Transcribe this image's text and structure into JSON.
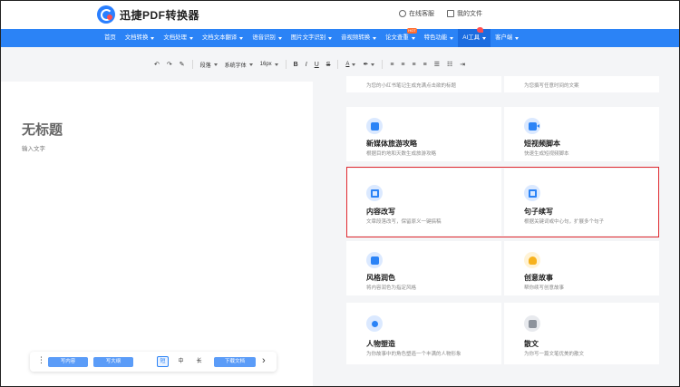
{
  "header": {
    "logo_text": "迅捷PDF转换器",
    "links": [
      {
        "label": "在线客服",
        "icon": "headset-icon"
      },
      {
        "label": "我的文件",
        "icon": "folder-icon"
      }
    ]
  },
  "nav": {
    "items": [
      {
        "label": "首页",
        "caret": false
      },
      {
        "label": "文档转换",
        "caret": true
      },
      {
        "label": "文档处理",
        "caret": true
      },
      {
        "label": "文档文本翻译",
        "caret": true
      },
      {
        "label": "语音识别",
        "caret": true
      },
      {
        "label": "图片文字识别",
        "caret": true
      },
      {
        "label": "音视频转换",
        "caret": true
      },
      {
        "label": "论文查重",
        "caret": true,
        "badge": "hot"
      },
      {
        "label": "特色功能",
        "caret": true
      },
      {
        "label": "AI工具",
        "caret": true,
        "active": true,
        "badge": "new"
      },
      {
        "label": "客户端",
        "caret": true
      }
    ]
  },
  "toolbar": {
    "paragraph": "段落",
    "font": "系统字体",
    "size": "16px",
    "bold": "B",
    "italic": "I",
    "underline": "U",
    "strike": "S",
    "font_color": "A"
  },
  "editor": {
    "title": "无标题",
    "hint": "输入文字"
  },
  "bottombar": {
    "write_content": "写内容",
    "write_outline": "写大纲",
    "lengths": [
      "短",
      "中",
      "长"
    ],
    "selected_length": "短",
    "download": "下载文档"
  },
  "cards": {
    "partial_left_desc": "为您的小红书笔记生成充满点击欲的标题",
    "partial_right_desc": "为您撰写任意时间的文案",
    "items": [
      {
        "title": "新媒体旅游攻略",
        "desc": "根据目的地和天数生成旅游攻略",
        "icon": "travel-icon"
      },
      {
        "title": "短视频脚本",
        "desc": "快速生成短视频脚本",
        "icon": "video-icon"
      },
      {
        "title": "内容改写",
        "desc": "文章段落改写，保留原义一键搞稿",
        "icon": "rewrite-icon"
      },
      {
        "title": "句子续写",
        "desc": "根据关键词或中心句，扩展多个句子",
        "icon": "continue-icon"
      },
      {
        "title": "风格润色",
        "desc": "将内容润色为指定风格",
        "icon": "pen-icon"
      },
      {
        "title": "创意故事",
        "desc": "帮你续写创意故事",
        "icon": "bulb-icon"
      },
      {
        "title": "人物塑造",
        "desc": "为你故事中的角色塑造一个丰满的人物形象",
        "icon": "person-icon"
      },
      {
        "title": "散文",
        "desc": "为你写一篇文笔优美的散文",
        "icon": "essay-icon"
      }
    ]
  },
  "colors": {
    "accent": "#2b83f6",
    "highlight": "#e0292f"
  }
}
